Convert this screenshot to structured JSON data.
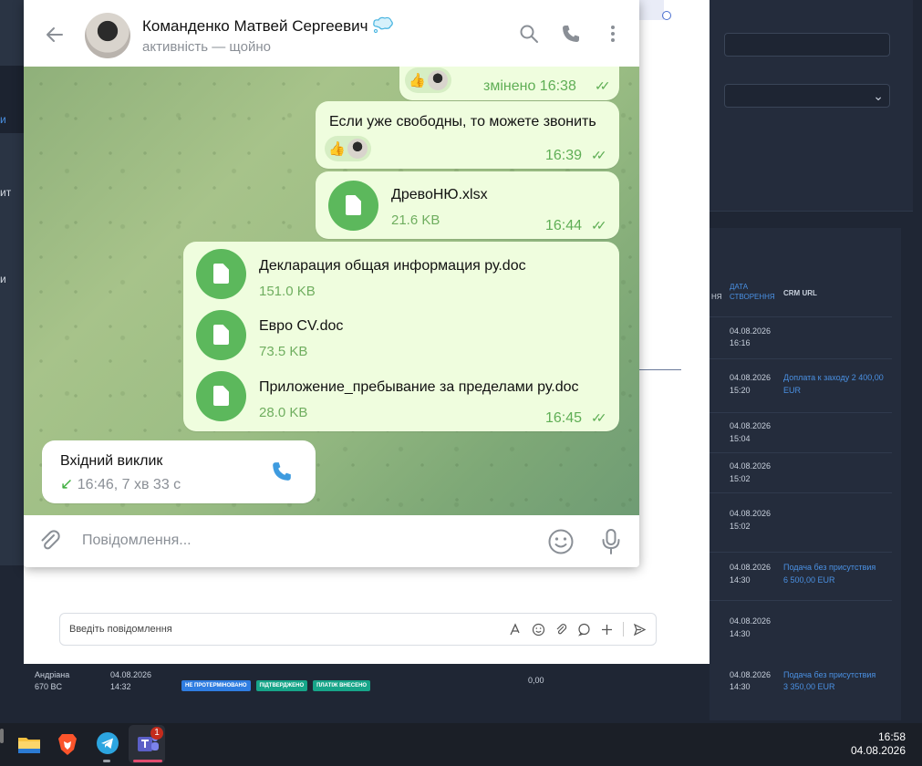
{
  "sidebar": {
    "items": [
      "и",
      "ит",
      "и"
    ]
  },
  "crm": {
    "headers": {
      "partial": "НЯ",
      "date": "ДАТА СТВОРЕННЯ",
      "crm_url": "CRM URL"
    },
    "select_value": "⌄",
    "rows": [
      {
        "date": "04.08.2026",
        "time": "16:16",
        "link1": "",
        "link2": ""
      },
      {
        "date": "04.08.2026",
        "time": "15:20",
        "link1": "Доплата к заходу 2 400,00",
        "link2": "EUR"
      },
      {
        "date": "04.08.2026",
        "time": "15:04",
        "link1": "",
        "link2": ""
      },
      {
        "date": "04.08.2026",
        "time": "15:02",
        "link1": "",
        "link2": ""
      },
      {
        "date": "04.08.2026",
        "time": "15:02",
        "link1": "",
        "link2": ""
      },
      {
        "date": "04.08.2026",
        "time": "14:30",
        "link1": "Подача без присутствия",
        "link2": "6 500,00 EUR"
      },
      {
        "date": "04.08.2026",
        "time": "14:30",
        "link1": "",
        "link2": ""
      }
    ],
    "bottom_row": {
      "name1": "Андріана",
      "name2": "670 BC",
      "date": "04.08.2026",
      "time": "14:32",
      "badges": [
        {
          "label": "НЕ ПРОТЕРМІНОВАНО",
          "color": "#2f7de1"
        },
        {
          "label": "ПІДТВЕРДЖЕНО",
          "color": "#17a589"
        },
        {
          "label": "ПЛАТІЖ ВНЕСЕНО",
          "color": "#17a589"
        }
      ],
      "amount": "0,00",
      "date2": "04.08.2026",
      "time2": "14:30",
      "link1": "Подача без присутствия",
      "link2": "3 350,00 EUR"
    }
  },
  "comment": {
    "placeholder": "Введіть повідомлення"
  },
  "telegram": {
    "contact_name": "Команденко Матвей Сергеевич",
    "status": "активність — щойно",
    "messages": {
      "m1": {
        "edited_time": "змінено 16:38",
        "reaction": "👍"
      },
      "m2": {
        "text": "Если уже свободны, то можете звонить",
        "reaction": "👍",
        "time": "16:39"
      },
      "m3": {
        "file_name": "ДревоНЮ.xlsx",
        "file_size": "21.6 KB",
        "time": "16:44"
      },
      "m4": {
        "files": [
          {
            "name": "Декларация общая информация ру.doc",
            "size": "151.0 KB"
          },
          {
            "name": "Евро CV.doc",
            "size": "73.5 KB"
          },
          {
            "name": "Приложение_пребывание за пределами ру.doc",
            "size": "28.0 KB"
          }
        ],
        "time": "16:45"
      },
      "call": {
        "title": "Вхідний виклик",
        "details": "16:46, 7 хв 33 с"
      }
    },
    "composer_placeholder": "Повідомлення..."
  },
  "taskbar": {
    "time": "16:58",
    "date": "04.08.2026",
    "teams_badge": "1",
    "apps": [
      "file-explorer-icon",
      "brave-icon",
      "telegram-icon",
      "teams-icon"
    ]
  },
  "colors": {
    "accent_green": "#5cb85c",
    "bubble_out": "#effdde",
    "crm_link": "#4a90e2"
  }
}
